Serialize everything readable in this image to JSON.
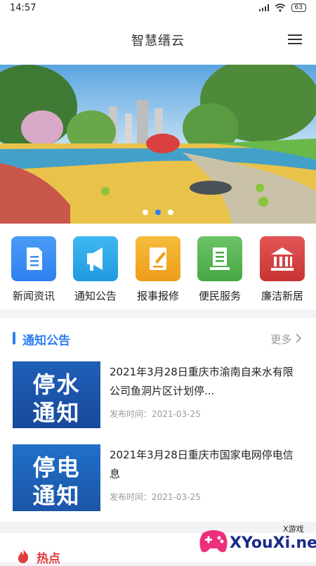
{
  "status": {
    "time": "14:57",
    "battery": "63"
  },
  "header": {
    "title": "智慧缙云"
  },
  "banner": {
    "slides": 3,
    "active_slide": 2
  },
  "quick_links": [
    {
      "label": "新闻资讯",
      "icon": "news-document-icon",
      "color": "#3a8ff0"
    },
    {
      "label": "通知公告",
      "icon": "megaphone-icon",
      "color": "#29a8e8"
    },
    {
      "label": "报事报修",
      "icon": "report-edit-icon",
      "color": "#f2a82a"
    },
    {
      "label": "便民服务",
      "icon": "service-doc-icon",
      "color": "#5cb55a"
    },
    {
      "label": "廉洁新居",
      "icon": "bank-building-icon",
      "color": "#d84545"
    }
  ],
  "notice": {
    "title": "通知公告",
    "more": "更多",
    "items": [
      {
        "thumb_top": "停水",
        "thumb_bottom": "通知",
        "title": "2021年3月28日重庆市渝南自来水有限公司鱼洞片区计划停...",
        "date": "发布时间：2021-03-25"
      },
      {
        "thumb_top": "停电",
        "thumb_bottom": "通知",
        "title": "2021年3月28日重庆市国家电网停电信息",
        "date": "发布时间：2021-03-25"
      }
    ]
  },
  "hot": {
    "title": "热点"
  },
  "watermark": {
    "text": "XYouXi.net",
    "small": "X游戏"
  },
  "colors": {
    "accent": "#2f7ff0",
    "hot": "#e03c3c"
  }
}
